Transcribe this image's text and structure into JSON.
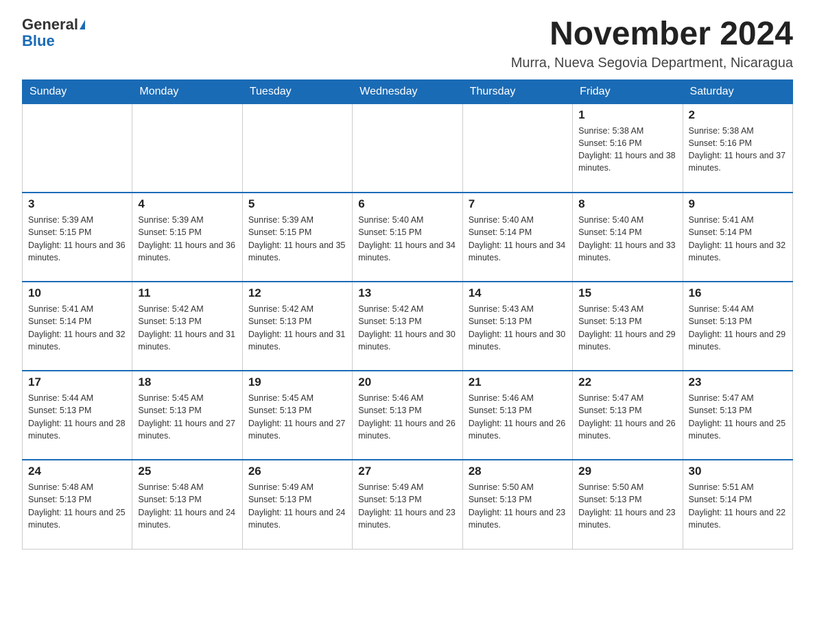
{
  "logo": {
    "general": "General",
    "blue": "Blue"
  },
  "title": "November 2024",
  "location": "Murra, Nueva Segovia Department, Nicaragua",
  "days_of_week": [
    "Sunday",
    "Monday",
    "Tuesday",
    "Wednesday",
    "Thursday",
    "Friday",
    "Saturday"
  ],
  "weeks": [
    [
      {
        "day": "",
        "sunrise": "",
        "sunset": "",
        "daylight": ""
      },
      {
        "day": "",
        "sunrise": "",
        "sunset": "",
        "daylight": ""
      },
      {
        "day": "",
        "sunrise": "",
        "sunset": "",
        "daylight": ""
      },
      {
        "day": "",
        "sunrise": "",
        "sunset": "",
        "daylight": ""
      },
      {
        "day": "",
        "sunrise": "",
        "sunset": "",
        "daylight": ""
      },
      {
        "day": "1",
        "sunrise": "Sunrise: 5:38 AM",
        "sunset": "Sunset: 5:16 PM",
        "daylight": "Daylight: 11 hours and 38 minutes."
      },
      {
        "day": "2",
        "sunrise": "Sunrise: 5:38 AM",
        "sunset": "Sunset: 5:16 PM",
        "daylight": "Daylight: 11 hours and 37 minutes."
      }
    ],
    [
      {
        "day": "3",
        "sunrise": "Sunrise: 5:39 AM",
        "sunset": "Sunset: 5:15 PM",
        "daylight": "Daylight: 11 hours and 36 minutes."
      },
      {
        "day": "4",
        "sunrise": "Sunrise: 5:39 AM",
        "sunset": "Sunset: 5:15 PM",
        "daylight": "Daylight: 11 hours and 36 minutes."
      },
      {
        "day": "5",
        "sunrise": "Sunrise: 5:39 AM",
        "sunset": "Sunset: 5:15 PM",
        "daylight": "Daylight: 11 hours and 35 minutes."
      },
      {
        "day": "6",
        "sunrise": "Sunrise: 5:40 AM",
        "sunset": "Sunset: 5:15 PM",
        "daylight": "Daylight: 11 hours and 34 minutes."
      },
      {
        "day": "7",
        "sunrise": "Sunrise: 5:40 AM",
        "sunset": "Sunset: 5:14 PM",
        "daylight": "Daylight: 11 hours and 34 minutes."
      },
      {
        "day": "8",
        "sunrise": "Sunrise: 5:40 AM",
        "sunset": "Sunset: 5:14 PM",
        "daylight": "Daylight: 11 hours and 33 minutes."
      },
      {
        "day": "9",
        "sunrise": "Sunrise: 5:41 AM",
        "sunset": "Sunset: 5:14 PM",
        "daylight": "Daylight: 11 hours and 32 minutes."
      }
    ],
    [
      {
        "day": "10",
        "sunrise": "Sunrise: 5:41 AM",
        "sunset": "Sunset: 5:14 PM",
        "daylight": "Daylight: 11 hours and 32 minutes."
      },
      {
        "day": "11",
        "sunrise": "Sunrise: 5:42 AM",
        "sunset": "Sunset: 5:13 PM",
        "daylight": "Daylight: 11 hours and 31 minutes."
      },
      {
        "day": "12",
        "sunrise": "Sunrise: 5:42 AM",
        "sunset": "Sunset: 5:13 PM",
        "daylight": "Daylight: 11 hours and 31 minutes."
      },
      {
        "day": "13",
        "sunrise": "Sunrise: 5:42 AM",
        "sunset": "Sunset: 5:13 PM",
        "daylight": "Daylight: 11 hours and 30 minutes."
      },
      {
        "day": "14",
        "sunrise": "Sunrise: 5:43 AM",
        "sunset": "Sunset: 5:13 PM",
        "daylight": "Daylight: 11 hours and 30 minutes."
      },
      {
        "day": "15",
        "sunrise": "Sunrise: 5:43 AM",
        "sunset": "Sunset: 5:13 PM",
        "daylight": "Daylight: 11 hours and 29 minutes."
      },
      {
        "day": "16",
        "sunrise": "Sunrise: 5:44 AM",
        "sunset": "Sunset: 5:13 PM",
        "daylight": "Daylight: 11 hours and 29 minutes."
      }
    ],
    [
      {
        "day": "17",
        "sunrise": "Sunrise: 5:44 AM",
        "sunset": "Sunset: 5:13 PM",
        "daylight": "Daylight: 11 hours and 28 minutes."
      },
      {
        "day": "18",
        "sunrise": "Sunrise: 5:45 AM",
        "sunset": "Sunset: 5:13 PM",
        "daylight": "Daylight: 11 hours and 27 minutes."
      },
      {
        "day": "19",
        "sunrise": "Sunrise: 5:45 AM",
        "sunset": "Sunset: 5:13 PM",
        "daylight": "Daylight: 11 hours and 27 minutes."
      },
      {
        "day": "20",
        "sunrise": "Sunrise: 5:46 AM",
        "sunset": "Sunset: 5:13 PM",
        "daylight": "Daylight: 11 hours and 26 minutes."
      },
      {
        "day": "21",
        "sunrise": "Sunrise: 5:46 AM",
        "sunset": "Sunset: 5:13 PM",
        "daylight": "Daylight: 11 hours and 26 minutes."
      },
      {
        "day": "22",
        "sunrise": "Sunrise: 5:47 AM",
        "sunset": "Sunset: 5:13 PM",
        "daylight": "Daylight: 11 hours and 26 minutes."
      },
      {
        "day": "23",
        "sunrise": "Sunrise: 5:47 AM",
        "sunset": "Sunset: 5:13 PM",
        "daylight": "Daylight: 11 hours and 25 minutes."
      }
    ],
    [
      {
        "day": "24",
        "sunrise": "Sunrise: 5:48 AM",
        "sunset": "Sunset: 5:13 PM",
        "daylight": "Daylight: 11 hours and 25 minutes."
      },
      {
        "day": "25",
        "sunrise": "Sunrise: 5:48 AM",
        "sunset": "Sunset: 5:13 PM",
        "daylight": "Daylight: 11 hours and 24 minutes."
      },
      {
        "day": "26",
        "sunrise": "Sunrise: 5:49 AM",
        "sunset": "Sunset: 5:13 PM",
        "daylight": "Daylight: 11 hours and 24 minutes."
      },
      {
        "day": "27",
        "sunrise": "Sunrise: 5:49 AM",
        "sunset": "Sunset: 5:13 PM",
        "daylight": "Daylight: 11 hours and 23 minutes."
      },
      {
        "day": "28",
        "sunrise": "Sunrise: 5:50 AM",
        "sunset": "Sunset: 5:13 PM",
        "daylight": "Daylight: 11 hours and 23 minutes."
      },
      {
        "day": "29",
        "sunrise": "Sunrise: 5:50 AM",
        "sunset": "Sunset: 5:13 PM",
        "daylight": "Daylight: 11 hours and 23 minutes."
      },
      {
        "day": "30",
        "sunrise": "Sunrise: 5:51 AM",
        "sunset": "Sunset: 5:14 PM",
        "daylight": "Daylight: 11 hours and 22 minutes."
      }
    ]
  ]
}
